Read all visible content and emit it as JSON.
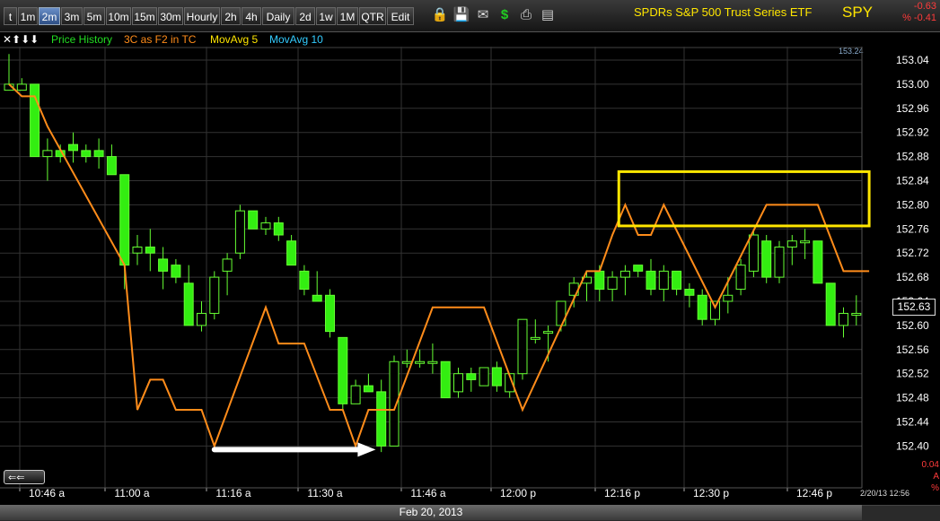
{
  "toolbar": {
    "buttons": [
      "t",
      "1m",
      "2m",
      "3m",
      "5m",
      "10m",
      "15m",
      "30m",
      "Hourly",
      "2h",
      "4h",
      "Daily",
      "2d",
      "1w",
      "1M",
      "QTR",
      "Edit"
    ],
    "active": "2m",
    "icons": [
      "folder-lock-icon",
      "save-disk-icon",
      "mail-envelope-icon",
      "dollar-sign-icon",
      "printer-icon",
      "notes-card-icon"
    ]
  },
  "instrument": {
    "name": "SPDRs S&P 500 Trust Series ETF",
    "ticker": "SPY",
    "change": "-0.63",
    "change_pct": "% -0.41"
  },
  "legend": {
    "controls": "✕⬆⬇⬇",
    "items": [
      {
        "label": "Price History",
        "color": "#22dd22"
      },
      {
        "label": "3C as F2 in TC",
        "color": "#ff8c1a"
      },
      {
        "label": "MovAvg 5",
        "color": "#ffe600"
      },
      {
        "label": "MovAvg 10",
        "color": "#33ccff"
      }
    ]
  },
  "footer": {
    "date": "Feb 20, 2013",
    "timestamp": "2/20/13 12:56",
    "right_values": [
      "0.04",
      "A",
      "%"
    ],
    "last_price": "152.63",
    "nav_label": "⇐⇐"
  },
  "colors": {
    "up": "#66ff33",
    "down": "#33ee11",
    "wick": "#66ff33",
    "indicator": "#ff8c1a",
    "box": "#ffe600",
    "arrow": "#ffffff",
    "grid": "#333333"
  },
  "chart_data": {
    "type": "candlestick",
    "title": "SPDRs S&P 500 Trust Series ETF",
    "ylim": [
      152.37,
      153.07
    ],
    "y_ticks": [
      153.04,
      153.0,
      152.96,
      152.92,
      152.88,
      152.84,
      152.8,
      152.76,
      152.72,
      152.68,
      152.64,
      152.6,
      152.56,
      152.52,
      152.48,
      152.44,
      152.4
    ],
    "top_marker": "153.24",
    "x_ticks": [
      "10:46 a",
      "11:00 a",
      "11:16 a",
      "11:30 a",
      "11:46 a",
      "12:00 p",
      "12:16 p",
      "12:30 p",
      "12:46 p"
    ],
    "candles": [
      {
        "o": 152.99,
        "h": 153.05,
        "l": 152.99,
        "c": 153.0
      },
      {
        "o": 152.99,
        "h": 153.01,
        "l": 152.99,
        "c": 153.0
      },
      {
        "o": 153.0,
        "h": 153.0,
        "l": 152.88,
        "c": 152.88
      },
      {
        "o": 152.88,
        "h": 152.91,
        "l": 152.84,
        "c": 152.89
      },
      {
        "o": 152.89,
        "h": 152.9,
        "l": 152.87,
        "c": 152.88
      },
      {
        "o": 152.9,
        "h": 152.92,
        "l": 152.87,
        "c": 152.89
      },
      {
        "o": 152.89,
        "h": 152.9,
        "l": 152.87,
        "c": 152.88
      },
      {
        "o": 152.89,
        "h": 152.91,
        "l": 152.86,
        "c": 152.88
      },
      {
        "o": 152.88,
        "h": 152.9,
        "l": 152.85,
        "c": 152.85
      },
      {
        "o": 152.85,
        "h": 152.85,
        "l": 152.66,
        "c": 152.7
      },
      {
        "o": 152.72,
        "h": 152.75,
        "l": 152.7,
        "c": 152.73
      },
      {
        "o": 152.73,
        "h": 152.76,
        "l": 152.69,
        "c": 152.72
      },
      {
        "o": 152.71,
        "h": 152.73,
        "l": 152.66,
        "c": 152.69
      },
      {
        "o": 152.7,
        "h": 152.71,
        "l": 152.67,
        "c": 152.68
      },
      {
        "o": 152.67,
        "h": 152.7,
        "l": 152.6,
        "c": 152.6
      },
      {
        "o": 152.6,
        "h": 152.64,
        "l": 152.59,
        "c": 152.62
      },
      {
        "o": 152.62,
        "h": 152.69,
        "l": 152.61,
        "c": 152.68
      },
      {
        "o": 152.69,
        "h": 152.72,
        "l": 152.65,
        "c": 152.71
      },
      {
        "o": 152.72,
        "h": 152.8,
        "l": 152.71,
        "c": 152.79
      },
      {
        "o": 152.79,
        "h": 152.79,
        "l": 152.76,
        "c": 152.76
      },
      {
        "o": 152.76,
        "h": 152.78,
        "l": 152.75,
        "c": 152.77
      },
      {
        "o": 152.77,
        "h": 152.78,
        "l": 152.74,
        "c": 152.75
      },
      {
        "o": 152.74,
        "h": 152.75,
        "l": 152.7,
        "c": 152.7
      },
      {
        "o": 152.69,
        "h": 152.7,
        "l": 152.65,
        "c": 152.66
      },
      {
        "o": 152.65,
        "h": 152.69,
        "l": 152.64,
        "c": 152.64
      },
      {
        "o": 152.65,
        "h": 152.66,
        "l": 152.58,
        "c": 152.59
      },
      {
        "o": 152.58,
        "h": 152.58,
        "l": 152.46,
        "c": 152.47
      },
      {
        "o": 152.47,
        "h": 152.51,
        "l": 152.47,
        "c": 152.5
      },
      {
        "o": 152.5,
        "h": 152.52,
        "l": 152.49,
        "c": 152.49
      },
      {
        "o": 152.49,
        "h": 152.51,
        "l": 152.39,
        "c": 152.4
      },
      {
        "o": 152.4,
        "h": 152.55,
        "l": 152.4,
        "c": 152.54
      },
      {
        "o": 152.54,
        "h": 152.56,
        "l": 152.53,
        "c": 152.54
      },
      {
        "o": 152.54,
        "h": 152.56,
        "l": 152.53,
        "c": 152.54
      },
      {
        "o": 152.54,
        "h": 152.57,
        "l": 152.52,
        "c": 152.54
      },
      {
        "o": 152.54,
        "h": 152.54,
        "l": 152.48,
        "c": 152.48
      },
      {
        "o": 152.49,
        "h": 152.53,
        "l": 152.48,
        "c": 152.52
      },
      {
        "o": 152.52,
        "h": 152.53,
        "l": 152.49,
        "c": 152.51
      },
      {
        "o": 152.5,
        "h": 152.53,
        "l": 152.5,
        "c": 152.53
      },
      {
        "o": 152.53,
        "h": 152.54,
        "l": 152.49,
        "c": 152.5
      },
      {
        "o": 152.49,
        "h": 152.52,
        "l": 152.48,
        "c": 152.52
      },
      {
        "o": 152.52,
        "h": 152.61,
        "l": 152.51,
        "c": 152.61
      },
      {
        "o": 152.58,
        "h": 152.61,
        "l": 152.57,
        "c": 152.58
      },
      {
        "o": 152.59,
        "h": 152.6,
        "l": 152.54,
        "c": 152.59
      },
      {
        "o": 152.6,
        "h": 152.64,
        "l": 152.59,
        "c": 152.64
      },
      {
        "o": 152.65,
        "h": 152.68,
        "l": 152.63,
        "c": 152.67
      },
      {
        "o": 152.67,
        "h": 152.69,
        "l": 152.64,
        "c": 152.68
      },
      {
        "o": 152.69,
        "h": 152.7,
        "l": 152.64,
        "c": 152.66
      },
      {
        "o": 152.66,
        "h": 152.69,
        "l": 152.64,
        "c": 152.68
      },
      {
        "o": 152.68,
        "h": 152.7,
        "l": 152.65,
        "c": 152.69
      },
      {
        "o": 152.7,
        "h": 152.7,
        "l": 152.68,
        "c": 152.69
      },
      {
        "o": 152.69,
        "h": 152.71,
        "l": 152.65,
        "c": 152.66
      },
      {
        "o": 152.66,
        "h": 152.7,
        "l": 152.64,
        "c": 152.69
      },
      {
        "o": 152.69,
        "h": 152.69,
        "l": 152.65,
        "c": 152.66
      },
      {
        "o": 152.66,
        "h": 152.67,
        "l": 152.63,
        "c": 152.65
      },
      {
        "o": 152.65,
        "h": 152.66,
        "l": 152.6,
        "c": 152.61
      },
      {
        "o": 152.61,
        "h": 152.64,
        "l": 152.6,
        "c": 152.64
      },
      {
        "o": 152.64,
        "h": 152.68,
        "l": 152.62,
        "c": 152.65
      },
      {
        "o": 152.66,
        "h": 152.71,
        "l": 152.65,
        "c": 152.7
      },
      {
        "o": 152.69,
        "h": 152.76,
        "l": 152.68,
        "c": 152.75
      },
      {
        "o": 152.74,
        "h": 152.75,
        "l": 152.67,
        "c": 152.68
      },
      {
        "o": 152.68,
        "h": 152.74,
        "l": 152.67,
        "c": 152.73
      },
      {
        "o": 152.73,
        "h": 152.75,
        "l": 152.7,
        "c": 152.74
      },
      {
        "o": 152.74,
        "h": 152.76,
        "l": 152.71,
        "c": 152.74
      },
      {
        "o": 152.74,
        "h": 152.74,
        "l": 152.67,
        "c": 152.67
      },
      {
        "o": 152.67,
        "h": 152.67,
        "l": 152.6,
        "c": 152.6
      },
      {
        "o": 152.6,
        "h": 152.63,
        "l": 152.58,
        "c": 152.62
      },
      {
        "o": 152.62,
        "h": 152.65,
        "l": 152.6,
        "c": 152.62
      }
    ],
    "indicator": [
      [
        0,
        153.0
      ],
      [
        1,
        152.98
      ],
      [
        2,
        152.98
      ],
      [
        3,
        152.93
      ],
      [
        9,
        152.7
      ],
      [
        10,
        152.46
      ],
      [
        11,
        152.51
      ],
      [
        12,
        152.51
      ],
      [
        13,
        152.46
      ],
      [
        15,
        152.46
      ],
      [
        16,
        152.4
      ],
      [
        20,
        152.63
      ],
      [
        21,
        152.57
      ],
      [
        23,
        152.57
      ],
      [
        25,
        152.46
      ],
      [
        26,
        152.46
      ],
      [
        27,
        152.4
      ],
      [
        28,
        152.46
      ],
      [
        30,
        152.46
      ],
      [
        33,
        152.63
      ],
      [
        37,
        152.63
      ],
      [
        40,
        152.46
      ],
      [
        45,
        152.69
      ],
      [
        46,
        152.69
      ],
      [
        47,
        152.75
      ],
      [
        48,
        152.8
      ],
      [
        49,
        152.75
      ],
      [
        50,
        152.75
      ],
      [
        51,
        152.8
      ],
      [
        55,
        152.63
      ],
      [
        59,
        152.8
      ],
      [
        63,
        152.8
      ],
      [
        65,
        152.69
      ],
      [
        67,
        152.69
      ]
    ],
    "annotations": [
      {
        "type": "box",
        "x1": 47.5,
        "x2": 67.0,
        "y1": 152.765,
        "y2": 152.855
      },
      {
        "type": "arrow",
        "x1": 16.0,
        "x2": 28.0,
        "y": 152.4
      }
    ]
  }
}
